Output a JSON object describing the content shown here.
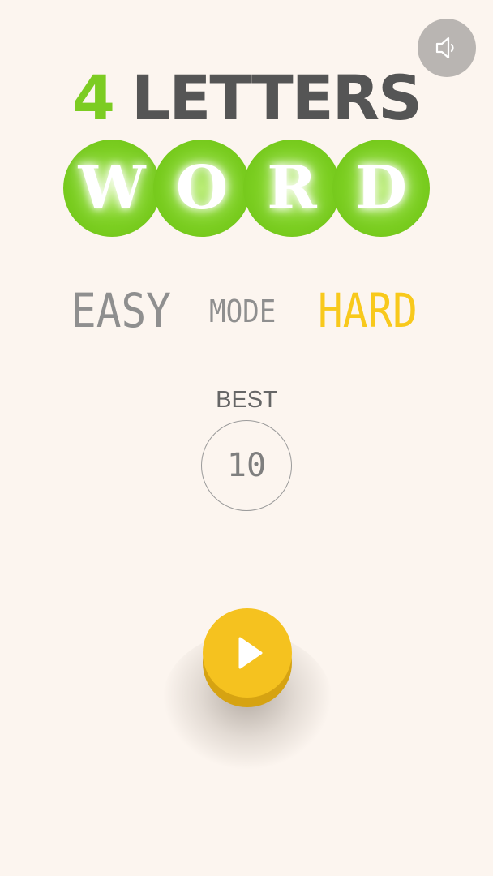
{
  "header": {
    "sound_button_icon": "speaker-icon"
  },
  "title": {
    "number": "4",
    "word": "LETTERS"
  },
  "logo_letters": [
    "W",
    "O",
    "R",
    "D"
  ],
  "mode": {
    "easy_label": "EASY",
    "mode_label": "MODE",
    "hard_label": "HARD",
    "selected": "HARD"
  },
  "best": {
    "label": "BEST",
    "value": "10"
  },
  "play_button": {
    "icon": "play-icon"
  },
  "colors": {
    "background": "#fcf5ef",
    "accent_green": "#7ccc22",
    "accent_yellow": "#f5c21f",
    "text_gray": "#8f8f8f",
    "title_gray": "#555555"
  }
}
